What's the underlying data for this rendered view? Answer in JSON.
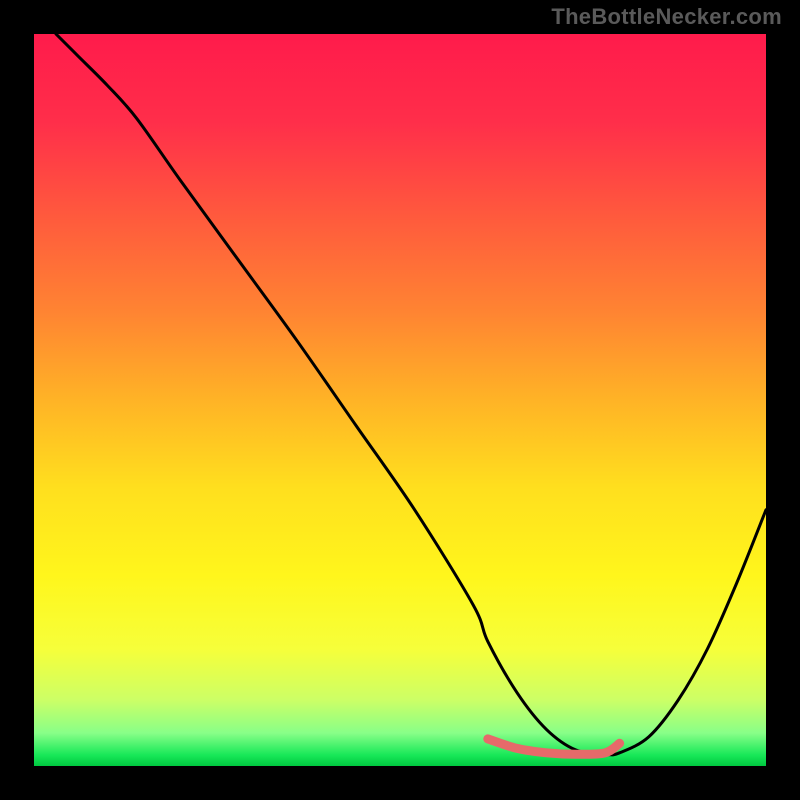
{
  "watermark": "TheBottleNecker.com",
  "colors": {
    "background": "#000000",
    "watermark_text": "#5a5a5a",
    "curve": "#000000",
    "accent_segment": "#e66a6a",
    "gradient_stops": [
      {
        "offset": 0.0,
        "color": "#ff1b4b"
      },
      {
        "offset": 0.12,
        "color": "#ff2e4a"
      },
      {
        "offset": 0.25,
        "color": "#ff5a3d"
      },
      {
        "offset": 0.38,
        "color": "#ff8432"
      },
      {
        "offset": 0.5,
        "color": "#ffb326"
      },
      {
        "offset": 0.62,
        "color": "#ffdf1e"
      },
      {
        "offset": 0.74,
        "color": "#fff61c"
      },
      {
        "offset": 0.84,
        "color": "#f6ff3a"
      },
      {
        "offset": 0.91,
        "color": "#ccff66"
      },
      {
        "offset": 0.955,
        "color": "#88ff88"
      },
      {
        "offset": 0.985,
        "color": "#18e858"
      },
      {
        "offset": 1.0,
        "color": "#00c840"
      }
    ]
  },
  "chart_data": {
    "type": "line",
    "title": "",
    "xlabel": "",
    "ylabel": "",
    "xlim": [
      0,
      100
    ],
    "ylim": [
      0,
      100
    ],
    "grid": false,
    "legend": false,
    "series": [
      {
        "name": "bottleneck-curve",
        "x": [
          3,
          6,
          10,
          14,
          20,
          28,
          36,
          44,
          52,
          60,
          62,
          66,
          70,
          74,
          78,
          80,
          84,
          88,
          92,
          96,
          100
        ],
        "y": [
          100,
          97,
          93,
          88.5,
          80,
          69,
          58,
          46.5,
          35,
          22,
          17,
          10,
          5,
          2.2,
          1.6,
          1.8,
          4,
          9,
          16,
          25,
          35
        ]
      }
    ],
    "accent_segment": {
      "name": "optimal-range",
      "x": [
        62,
        66,
        70,
        74,
        78,
        80
      ],
      "y": [
        3.7,
        2.4,
        1.8,
        1.6,
        1.8,
        3.1
      ]
    }
  }
}
